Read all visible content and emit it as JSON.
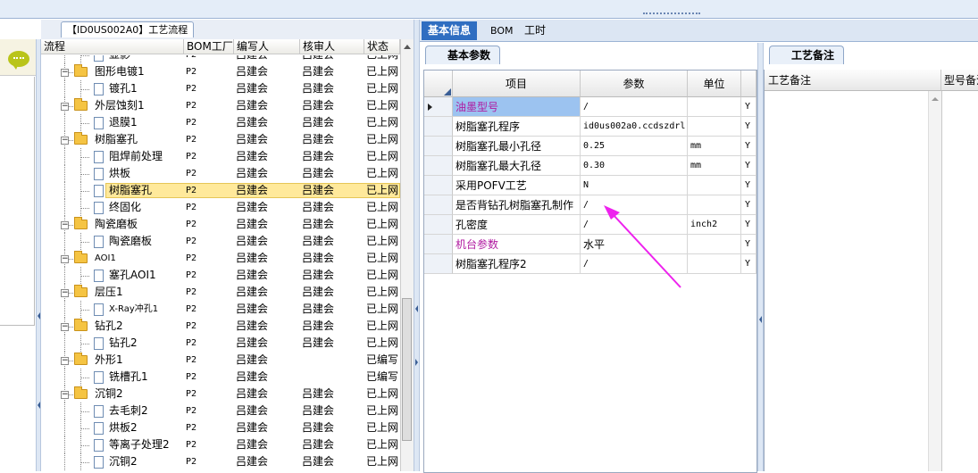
{
  "window": {
    "left_tab_title": "【ID0US002A0】工艺流程"
  },
  "tree": {
    "columns": [
      "流程",
      "BOM工厂",
      "编写人",
      "核审人",
      "状态"
    ],
    "rows": [
      {
        "level": 2,
        "type": "doc",
        "name": "显影",
        "bom": "P2",
        "writer": "吕建会",
        "reviewer": "吕建会",
        "status": "已上网"
      },
      {
        "level": 1,
        "type": "folder",
        "name": "图形电镀1",
        "bom": "P2",
        "writer": "吕建会",
        "reviewer": "吕建会",
        "status": "已上网"
      },
      {
        "level": 2,
        "type": "doc",
        "name": "镀孔1",
        "bom": "P2",
        "writer": "吕建会",
        "reviewer": "吕建会",
        "status": "已上网"
      },
      {
        "level": 1,
        "type": "folder",
        "name": "外层蚀刻1",
        "bom": "P2",
        "writer": "吕建会",
        "reviewer": "吕建会",
        "status": "已上网"
      },
      {
        "level": 2,
        "type": "doc",
        "name": "退膜1",
        "bom": "P2",
        "writer": "吕建会",
        "reviewer": "吕建会",
        "status": "已上网"
      },
      {
        "level": 1,
        "type": "folder",
        "name": "树脂塞孔",
        "bom": "P2",
        "writer": "吕建会",
        "reviewer": "吕建会",
        "status": "已上网"
      },
      {
        "level": 2,
        "type": "doc",
        "name": "阻焊前处理",
        "bom": "P2",
        "writer": "吕建会",
        "reviewer": "吕建会",
        "status": "已上网"
      },
      {
        "level": 2,
        "type": "doc",
        "name": "烘板",
        "bom": "P2",
        "writer": "吕建会",
        "reviewer": "吕建会",
        "status": "已上网"
      },
      {
        "level": 2,
        "type": "doc",
        "name": "树脂塞孔",
        "bom": "P2",
        "writer": "吕建会",
        "reviewer": "吕建会",
        "status": "已上网",
        "selected": true
      },
      {
        "level": 2,
        "type": "doc",
        "name": "终固化",
        "bom": "P2",
        "writer": "吕建会",
        "reviewer": "吕建会",
        "status": "已上网"
      },
      {
        "level": 1,
        "type": "folder",
        "name": "陶瓷磨板",
        "bom": "P2",
        "writer": "吕建会",
        "reviewer": "吕建会",
        "status": "已上网"
      },
      {
        "level": 2,
        "type": "doc",
        "name": "陶瓷磨板",
        "bom": "P2",
        "writer": "吕建会",
        "reviewer": "吕建会",
        "status": "已上网"
      },
      {
        "level": 1,
        "type": "folder",
        "name": "AOI1",
        "bom": "P2",
        "writer": "吕建会",
        "reviewer": "吕建会",
        "status": "已上网"
      },
      {
        "level": 2,
        "type": "doc",
        "name": "塞孔AOI1",
        "bom": "P2",
        "writer": "吕建会",
        "reviewer": "吕建会",
        "status": "已上网"
      },
      {
        "level": 1,
        "type": "folder",
        "name": "层压1",
        "bom": "P2",
        "writer": "吕建会",
        "reviewer": "吕建会",
        "status": "已上网"
      },
      {
        "level": 2,
        "type": "doc",
        "name": "X-Ray冲孔1",
        "bom": "P2",
        "writer": "吕建会",
        "reviewer": "吕建会",
        "status": "已上网"
      },
      {
        "level": 1,
        "type": "folder",
        "name": "钻孔2",
        "bom": "P2",
        "writer": "吕建会",
        "reviewer": "吕建会",
        "status": "已上网"
      },
      {
        "level": 2,
        "type": "doc",
        "name": "钻孔2",
        "bom": "P2",
        "writer": "吕建会",
        "reviewer": "吕建会",
        "status": "已上网"
      },
      {
        "level": 1,
        "type": "folder",
        "name": "外形1",
        "bom": "P2",
        "writer": "吕建会",
        "reviewer": "",
        "status": "已编写"
      },
      {
        "level": 2,
        "type": "doc",
        "name": "铣槽孔1",
        "bom": "P2",
        "writer": "吕建会",
        "reviewer": "",
        "status": "已编写"
      },
      {
        "level": 1,
        "type": "folder",
        "name": "沉铜2",
        "bom": "P2",
        "writer": "吕建会",
        "reviewer": "吕建会",
        "status": "已上网"
      },
      {
        "level": 2,
        "type": "doc",
        "name": "去毛刺2",
        "bom": "P2",
        "writer": "吕建会",
        "reviewer": "吕建会",
        "status": "已上网"
      },
      {
        "level": 2,
        "type": "doc",
        "name": "烘板2",
        "bom": "P2",
        "writer": "吕建会",
        "reviewer": "吕建会",
        "status": "已上网"
      },
      {
        "level": 2,
        "type": "doc",
        "name": "等离子处理2",
        "bom": "P2",
        "writer": "吕建会",
        "reviewer": "吕建会",
        "status": "已上网"
      },
      {
        "level": 2,
        "type": "doc",
        "name": "沉铜2",
        "bom": "P2",
        "writer": "吕建会",
        "reviewer": "吕建会",
        "status": "已上网"
      }
    ]
  },
  "right_tabs": [
    "基本信息",
    "BOM",
    "工时"
  ],
  "basic_params": {
    "subtab": "基本参数",
    "columns": [
      "项目",
      "参数",
      "单位"
    ],
    "rows": [
      {
        "item": "油墨型号",
        "param": "/",
        "unit": "",
        "flag": "Y",
        "highlight": true,
        "current": true
      },
      {
        "item": "树脂塞孔程序",
        "param": "id0us002a0.ccdszdrl",
        "unit": "",
        "flag": "Y"
      },
      {
        "item": "树脂塞孔最小孔径",
        "param": "0.25",
        "unit": "mm",
        "flag": "Y"
      },
      {
        "item": "树脂塞孔最大孔径",
        "param": "0.30",
        "unit": "mm",
        "flag": "Y"
      },
      {
        "item": "采用POFV工艺",
        "param": "N",
        "unit": "",
        "flag": "Y"
      },
      {
        "item": "是否背钻孔树脂塞孔制作",
        "param": "/",
        "unit": "",
        "flag": "Y"
      },
      {
        "item": "孔密度",
        "param": "/",
        "unit": "inch2",
        "flag": "Y"
      },
      {
        "item": "机台参数",
        "param": "水平",
        "unit": "",
        "flag": "Y",
        "highlight": true
      },
      {
        "item": "树脂塞孔程序2",
        "param": "/",
        "unit": "",
        "flag": "Y"
      }
    ]
  },
  "remarks": {
    "subtab": "工艺备注",
    "columns": [
      "工艺备注",
      "型号备注"
    ]
  },
  "colors": {
    "accent_tab": "#2f6ec1",
    "highlight_text": "#b01aa0",
    "selection": "#ffe99b",
    "annotation_arrow": "#ee22ee"
  },
  "icons": [
    "chat-bubble-icon",
    "folder-icon",
    "document-icon",
    "expand-toggle-icon",
    "row-pointer-icon",
    "annotation-arrow"
  ]
}
